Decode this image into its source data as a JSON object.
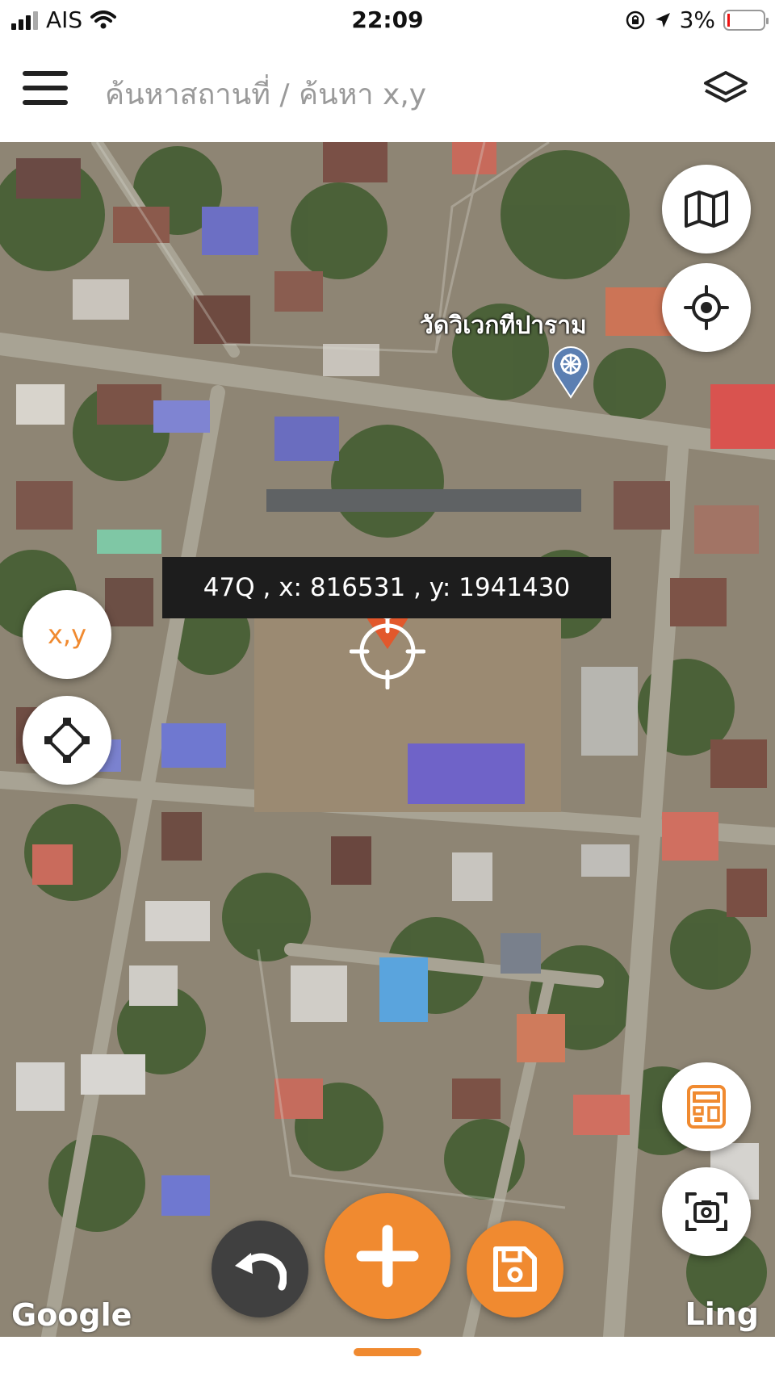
{
  "status_bar": {
    "carrier": "AIS",
    "time": "22:09",
    "battery": "3%"
  },
  "app_bar": {
    "title": "ค้นหาสถานที่ / ค้นหา x,y",
    "menu_icon": "hamburger-menu-icon",
    "layers_icon": "layers-icon"
  },
  "map": {
    "coordinate_readout": "47Q , x: 816531 , y: 1941430",
    "poi_label": "วัดวิเวกทีปาราม",
    "poi_icon": "dharma-wheel-pin-icon",
    "attribution_left": "Google",
    "attribution_right": "Ling"
  },
  "controls": {
    "map_type_icon": "map-icon",
    "locate_icon": "crosshair-locate-icon",
    "xy_label": "x,y",
    "polygon_icon": "diamond-polygon-icon",
    "calculator_icon": "calculator-icon",
    "screenshot_icon": "screen-capture-icon",
    "undo_icon": "undo-icon",
    "add_icon": "plus-icon",
    "save_icon": "save-file-icon"
  },
  "colors": {
    "accent": "#f08a30",
    "pin": "#e2582c",
    "readout_bg": "#1d1d1d"
  }
}
